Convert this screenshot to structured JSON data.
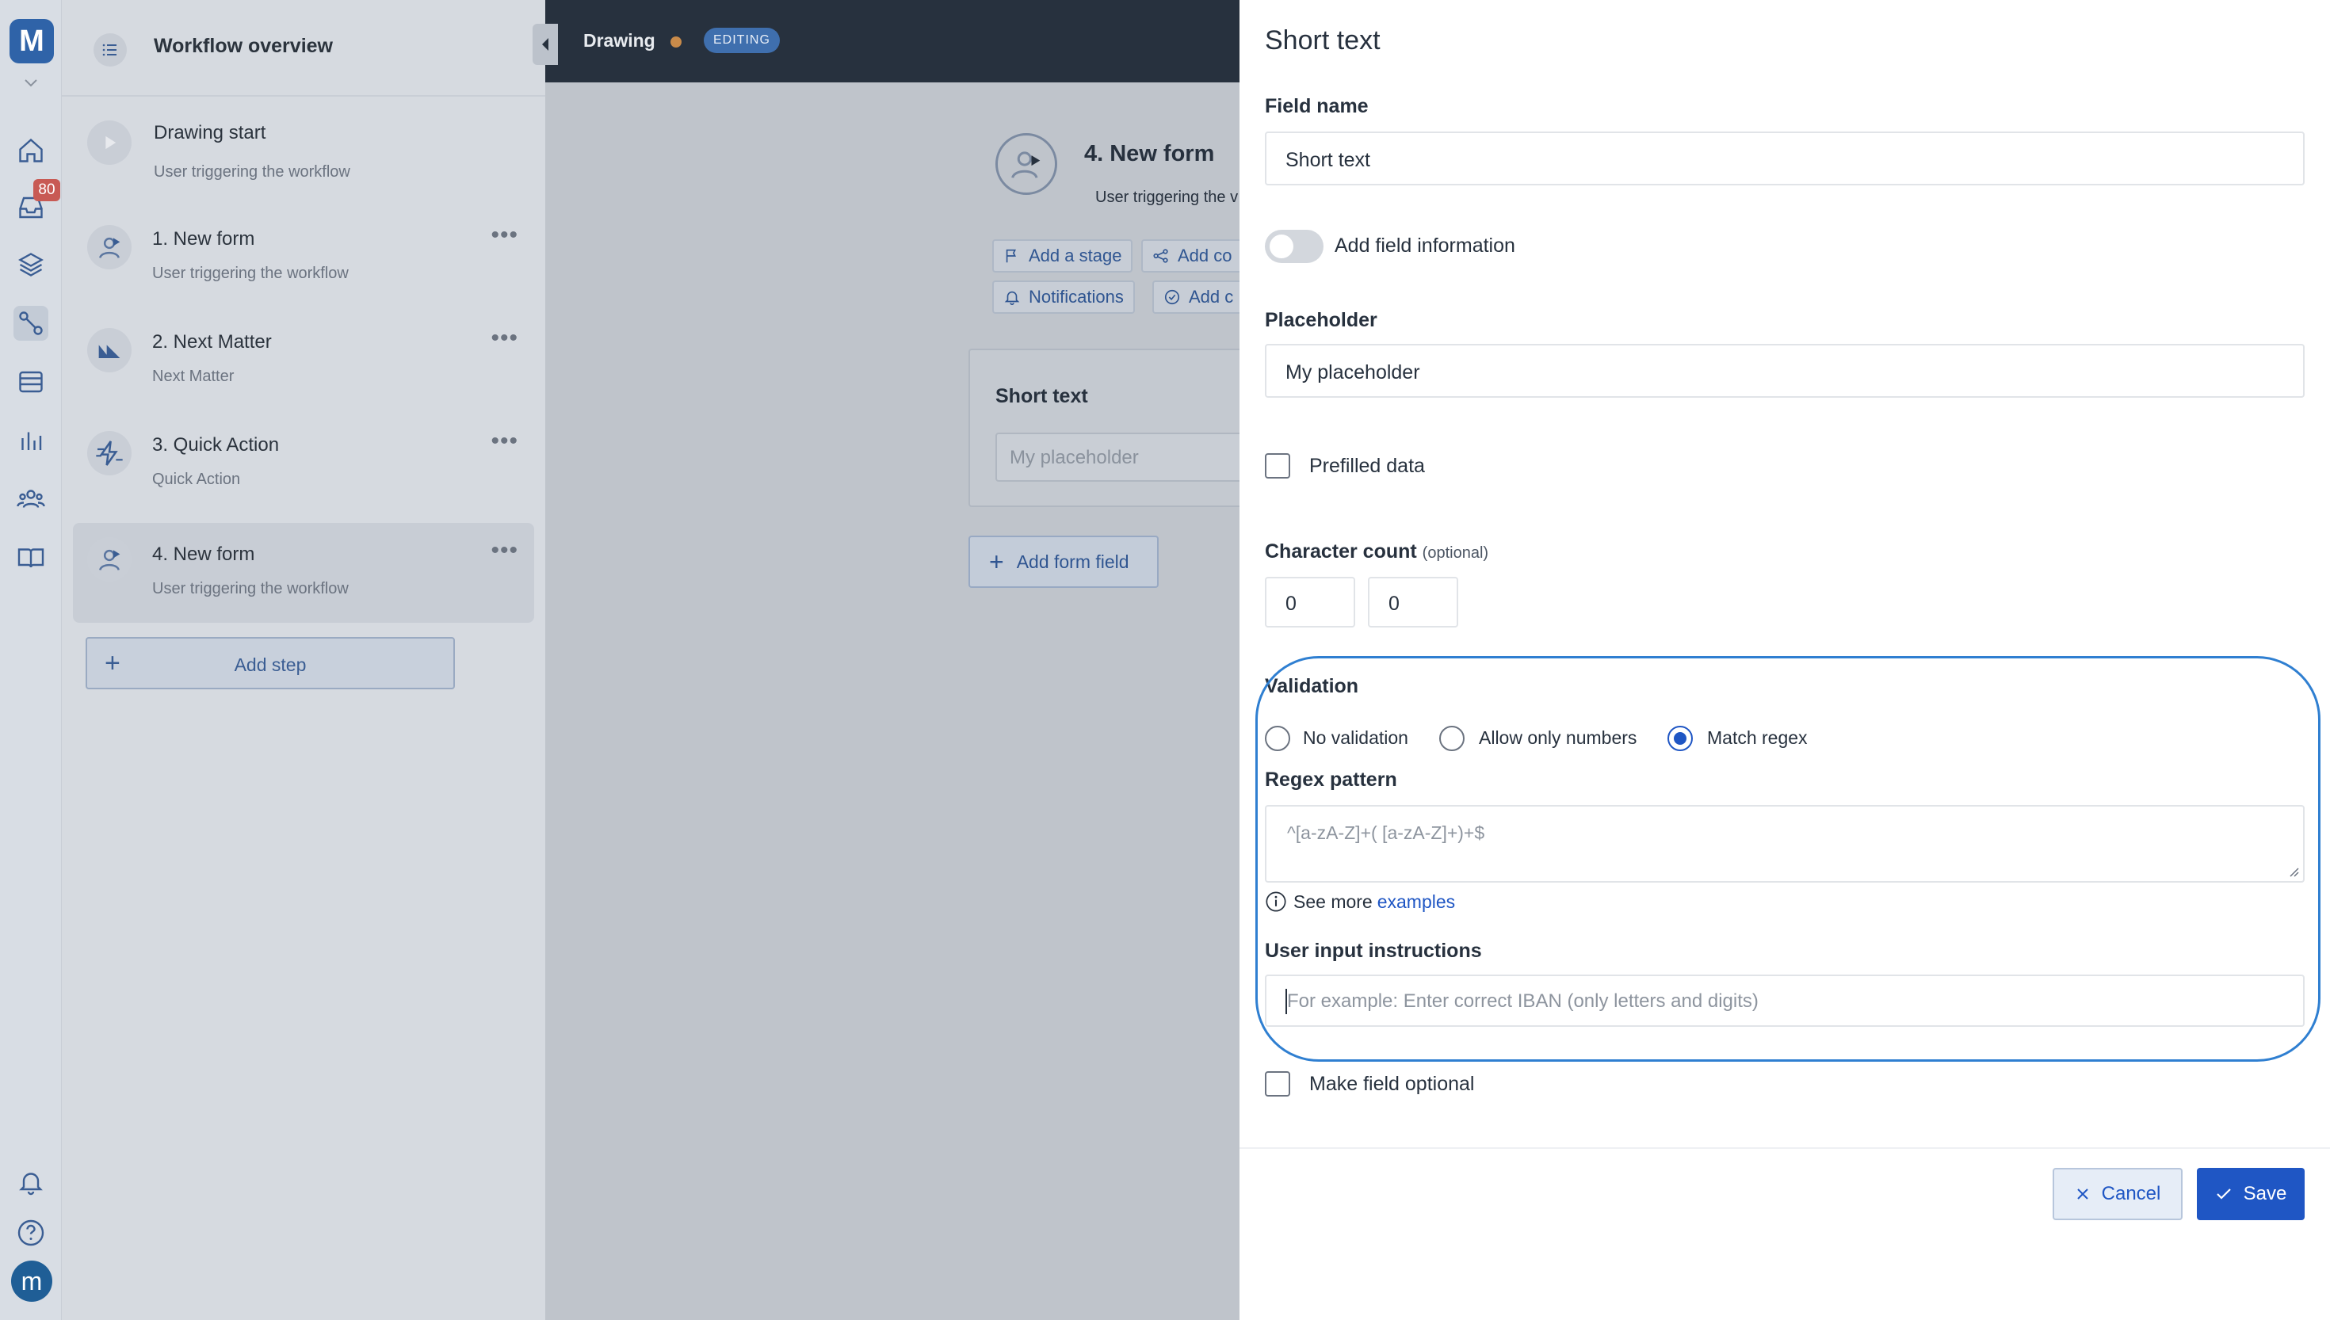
{
  "rail": {
    "logo": "M",
    "badge": "80",
    "avatar": "m",
    "icons": [
      "chevron-down-icon",
      "home-icon",
      "inbox-icon",
      "layers-icon",
      "workflow-icon",
      "list-icon",
      "chart-icon",
      "users-icon",
      "book-icon",
      "bell-icon",
      "help-icon"
    ]
  },
  "workflow": {
    "title": "Workflow overview",
    "steps": [
      {
        "title": "Drawing start",
        "subtitle": "User triggering the workflow"
      },
      {
        "title": "1. New form",
        "subtitle": "User triggering the workflow"
      },
      {
        "title": "2. Next Matter",
        "subtitle": "Next Matter"
      },
      {
        "title": "3. Quick Action",
        "subtitle": "Quick Action"
      },
      {
        "title": "4. New form",
        "subtitle": "User triggering the workflow"
      }
    ],
    "add_step": "Add step"
  },
  "topbar": {
    "title": "Drawing",
    "badge": "EDITING",
    "dot_color": "#c98b4a"
  },
  "canvas": {
    "node_title": "4. New form",
    "node_subtitle": "User triggering the v",
    "chips": [
      "Add a stage",
      "Add co",
      "Notifications",
      "Add c"
    ],
    "card_title": "Short text",
    "card_placeholder": "My placeholder",
    "add_form_field": "Add form field"
  },
  "panel": {
    "title": "Short text",
    "field_name_label": "Field name",
    "field_name_value": "Short text",
    "add_field_info": "Add field information",
    "placeholder_label": "Placeholder",
    "placeholder_value": "My placeholder",
    "prefilled": "Prefilled data",
    "char_count_label": "Character count",
    "char_count_optional": "(optional)",
    "char_min": "0",
    "char_max": "0",
    "validation_label": "Validation",
    "validation_options": [
      "No validation",
      "Allow only numbers",
      "Match regex"
    ],
    "validation_selected": "Match regex",
    "regex_label": "Regex pattern",
    "regex_placeholder": "^[a-zA-Z]+( [a-zA-Z]+)+$",
    "see_more": "See more",
    "examples_link": "examples",
    "instructions_label": "User input instructions",
    "instructions_placeholder": "For example: Enter correct IBAN (only letters and digits)",
    "make_optional": "Make field optional",
    "cancel": "Cancel",
    "save": "Save",
    "accent_color": "#1f56c4",
    "highlight_color": "#2f7fd1"
  }
}
